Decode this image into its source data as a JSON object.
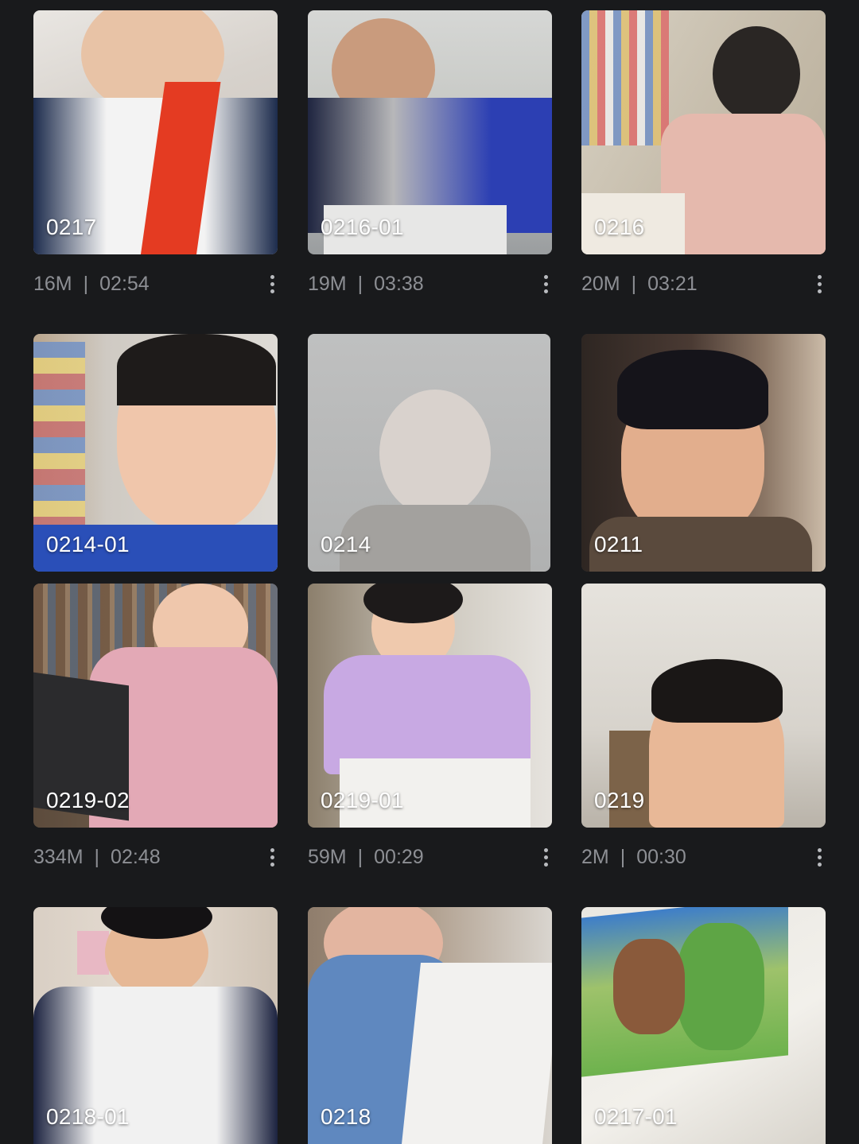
{
  "rows": [
    {
      "tiles": [
        {
          "label": "0217",
          "size": "16M",
          "duration": "02:54"
        },
        {
          "label": "0216-01",
          "size": "19M",
          "duration": "03:38"
        },
        {
          "label": "0216",
          "size": "20M",
          "duration": "03:21"
        }
      ]
    },
    {
      "tiles": [
        {
          "label": "0214-01"
        },
        {
          "label": "0214"
        },
        {
          "label": "0211"
        }
      ]
    },
    {
      "tiles": [
        {
          "label": "0219-02",
          "size": "334M",
          "duration": "02:48"
        },
        {
          "label": "0219-01",
          "size": "59M",
          "duration": "00:29"
        },
        {
          "label": "0219",
          "size": "2M",
          "duration": "00:30"
        }
      ]
    },
    {
      "tiles": [
        {
          "label": "0218-01"
        },
        {
          "label": "0218"
        },
        {
          "label": "0217-01"
        }
      ]
    }
  ],
  "meta_separator": "|",
  "icons": {
    "more": "more-vertical-icon"
  },
  "colors": {
    "background": "#191a1c",
    "meta_text": "#8d8f94",
    "label_text": "#ffffff"
  }
}
